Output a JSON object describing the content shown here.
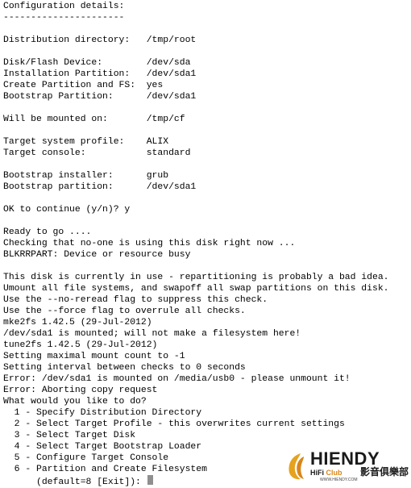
{
  "terminal": {
    "lines": [
      "Configuration details:",
      "----------------------",
      "",
      "Distribution directory:   /tmp/root",
      "",
      "Disk/Flash Device:        /dev/sda",
      "Installation Partition:   /dev/sda1",
      "Create Partition and FS:  yes",
      "Bootstrap Partition:      /dev/sda1",
      "",
      "Will be mounted on:       /tmp/cf",
      "",
      "Target system profile:    ALIX",
      "Target console:           standard",
      "",
      "Bootstrap installer:      grub",
      "Bootstrap partition:      /dev/sda1",
      "",
      "OK to continue (y/n)? y",
      "",
      "Ready to go ....",
      "Checking that no-one is using this disk right now ...",
      "BLKRRPART: Device or resource busy",
      "",
      "This disk is currently in use - repartitioning is probably a bad idea.",
      "Umount all file systems, and swapoff all swap partitions on this disk.",
      "Use the --no-reread flag to suppress this check.",
      "Use the --force flag to overrule all checks.",
      "mke2fs 1.42.5 (29-Jul-2012)",
      "/dev/sda1 is mounted; will not make a filesystem here!",
      "tune2fs 1.42.5 (29-Jul-2012)",
      "Setting maximal mount count to -1",
      "Setting interval between checks to 0 seconds",
      "Error: /dev/sda1 is mounted on /media/usb0 - please unmount it!",
      "Error: Aborting copy request",
      "What would you like to do?",
      "  1 - Specify Distribution Directory",
      "  2 - Select Target Profile - this overwrites current settings",
      "  3 - Select Target Disk",
      "  4 - Select Target Bootstrap Loader",
      "  5 - Configure Target Console",
      "  6 - Partition and Create Filesystem"
    ],
    "prompt": "      (default=8 [Exit]): ",
    "cursor_color": "#8f8f8f"
  },
  "watermark": {
    "brand": "HIENDY",
    "sub_left": "HiFi ",
    "sub_club": "Club",
    "cjk": "影音俱樂部",
    "url": "WWW.HIENDY.COM",
    "accent_color": "#d8861a"
  }
}
